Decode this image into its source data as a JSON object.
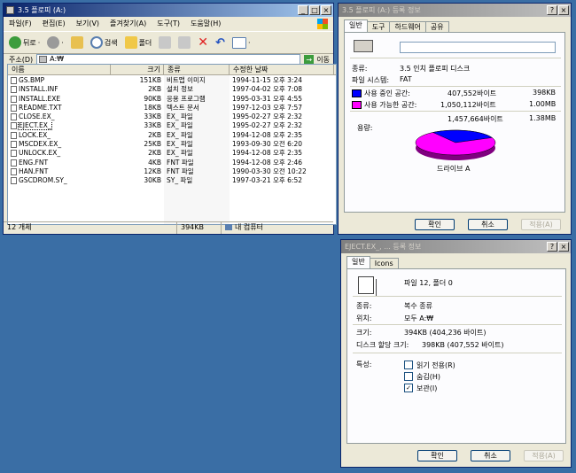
{
  "explorer": {
    "title": "3.5 플로피 (A:)",
    "menu": [
      "파일(F)",
      "편집(E)",
      "보기(V)",
      "즐겨찾기(A)",
      "도구(T)",
      "도움말(H)"
    ],
    "toolbar": {
      "back": "뒤로",
      "search": "검색",
      "folders": "폴더"
    },
    "address_label": "주소(D)",
    "address_value": "A:₩",
    "go_label": "이동",
    "columns": [
      "이름",
      "크기",
      "종류",
      "수정한 날짜"
    ],
    "files": [
      {
        "name": "GS.BMP",
        "size": "151KB",
        "type": "비트맵 이미지",
        "date": "1994-11-15 오후 3:24"
      },
      {
        "name": "INSTALL.INF",
        "size": "2KB",
        "type": "설치 정보",
        "date": "1997-04-02 오후 7:08"
      },
      {
        "name": "INSTALL.EXE",
        "size": "90KB",
        "type": "응용 프로그램",
        "date": "1995-03-31 오후 4:55"
      },
      {
        "name": "README.TXT",
        "size": "18KB",
        "type": "텍스트 문서",
        "date": "1997-12-03 오후 7:57"
      },
      {
        "name": "CLOSE.EX_",
        "size": "33KB",
        "type": "EX_ 파일",
        "date": "1995-02-27 오후 2:32"
      },
      {
        "name": "EJECT.EX_",
        "size": "33KB",
        "type": "EX_ 파일",
        "date": "1995-02-27 오후 2:32"
      },
      {
        "name": "LOCK.EX_",
        "size": "2KB",
        "type": "EX_ 파일",
        "date": "1994-12-08 오후 2:35"
      },
      {
        "name": "MSCDEX.EX_",
        "size": "25KB",
        "type": "EX_ 파일",
        "date": "1993-09-30 오전 6:20"
      },
      {
        "name": "UNLOCK.EX_",
        "size": "2KB",
        "type": "EX_ 파일",
        "date": "1994-12-08 오후 2:35"
      },
      {
        "name": "ENG.FNT",
        "size": "4KB",
        "type": "FNT 파일",
        "date": "1994-12-08 오후 2:46"
      },
      {
        "name": "HAN.FNT",
        "size": "12KB",
        "type": "FNT 파일",
        "date": "1990-03-30 오전 10:22"
      },
      {
        "name": "GSCDROM.SY_",
        "size": "30KB",
        "type": "SY_ 파일",
        "date": "1997-03-21 오후 6:52"
      }
    ],
    "status": {
      "count": "12 개체",
      "size": "394KB",
      "location": "내 컴퓨터"
    }
  },
  "drive_props": {
    "title": "3.5 플로피 (A:) 등록 정보",
    "tabs": [
      "일반",
      "도구",
      "하드웨어",
      "공유"
    ],
    "type_label": "종류:",
    "type_value": "3.5 인치 플로피 디스크",
    "fs_label": "파일 시스템:",
    "fs_value": "FAT",
    "used_label": "사용 중인 공간:",
    "used_bytes": "407,552바이트",
    "used_kb": "398KB",
    "free_label": "사용 가능한 공간:",
    "free_bytes": "1,050,112바이트",
    "free_mb": "1.00MB",
    "cap_label": "용량:",
    "cap_bytes": "1,457,664바이트",
    "cap_mb": "1.38MB",
    "drive_label": "드라이브 A",
    "used_fraction": 0.28,
    "used_color": "#0000ff",
    "free_color": "#ff00ff",
    "buttons": [
      "확인",
      "취소",
      "적용(A)"
    ]
  },
  "file_props": {
    "title": "EJECT.EX_, ... 등록 정보",
    "tabs": [
      "일반",
      "Icons"
    ],
    "summary": "파일 12, 폴더 0",
    "type_label": "종류:",
    "type_value": "복수 종류",
    "loc_label": "위치:",
    "loc_value": "모두 A:₩",
    "size_label": "크기:",
    "size_value": "394KB (404,236 바이트)",
    "disk_label": "디스크 할당 크기:",
    "disk_value": "398KB (407,552 바이트)",
    "attr_label": "특성:",
    "attrs": [
      {
        "label": "읽기 전용(R)",
        "checked": false
      },
      {
        "label": "숨김(H)",
        "checked": false
      },
      {
        "label": "보관(I)",
        "checked": true
      }
    ],
    "buttons": [
      "확인",
      "취소",
      "적용(A)"
    ]
  }
}
